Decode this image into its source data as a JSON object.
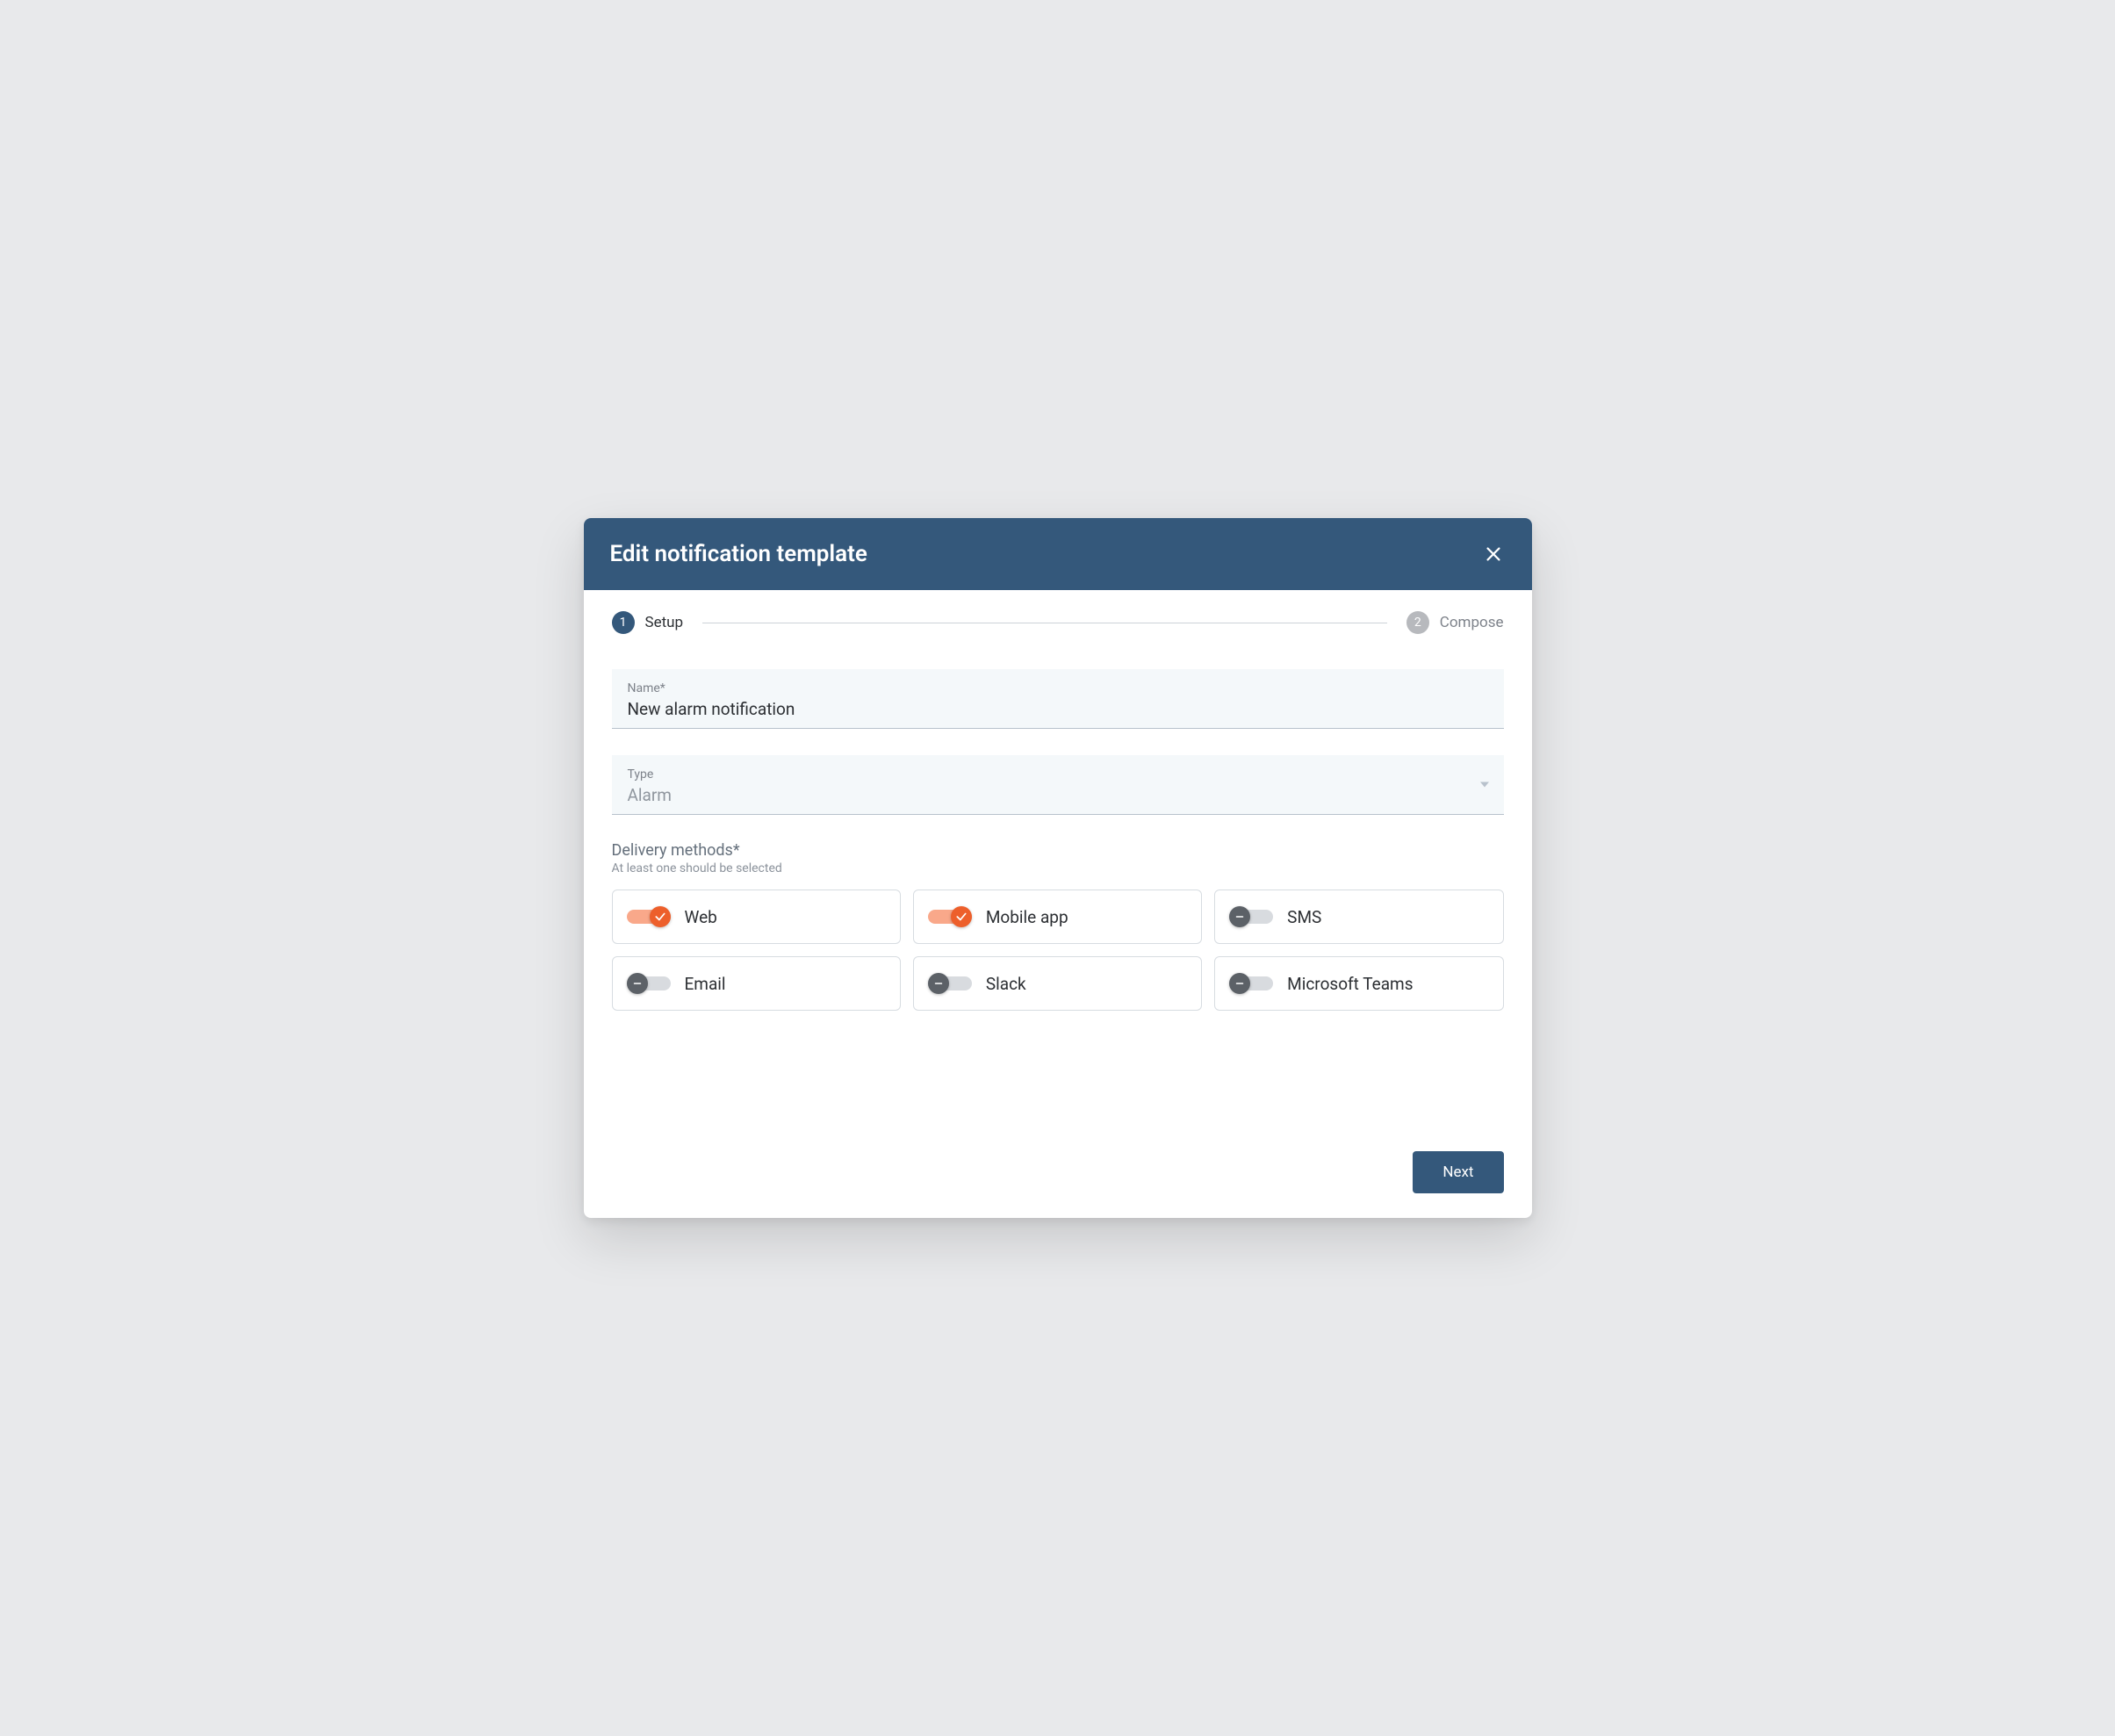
{
  "dialog": {
    "title": "Edit notification template",
    "close_label": "Close"
  },
  "stepper": {
    "steps": [
      {
        "number": "1",
        "label": "Setup",
        "active": true
      },
      {
        "number": "2",
        "label": "Compose",
        "active": false
      }
    ]
  },
  "form": {
    "name_label": "Name*",
    "name_value": "New alarm notification",
    "type_label": "Type",
    "type_value": "Alarm",
    "type_disabled": true
  },
  "delivery": {
    "title": "Delivery methods*",
    "hint": "At least one should be selected",
    "methods": [
      {
        "key": "web",
        "label": "Web",
        "enabled": true
      },
      {
        "key": "mobile-app",
        "label": "Mobile app",
        "enabled": true
      },
      {
        "key": "sms",
        "label": "SMS",
        "enabled": false
      },
      {
        "key": "email",
        "label": "Email",
        "enabled": false
      },
      {
        "key": "slack",
        "label": "Slack",
        "enabled": false
      },
      {
        "key": "microsoft-teams",
        "label": "Microsoft Teams",
        "enabled": false
      }
    ]
  },
  "footer": {
    "next_label": "Next"
  }
}
